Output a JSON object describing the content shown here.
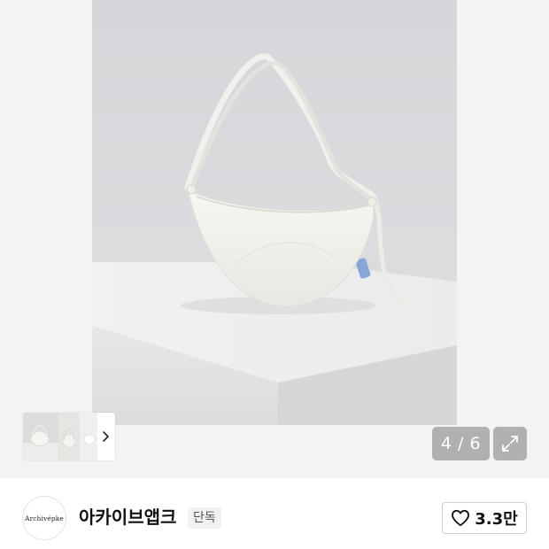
{
  "gallery": {
    "image_counter": "4 / 6",
    "expand_icon": "expand-icon",
    "thumbnail_next_icon": "chevron-right-icon"
  },
  "brand": {
    "logo_text": "Archivépke",
    "name": "아카이브앱크",
    "badge": "단독"
  },
  "like": {
    "icon": "heart-outline-icon",
    "count": "3.3만"
  },
  "colors": {
    "badge_bg": "#f1f1f1",
    "overlay_bg": "#787878",
    "border": "#cfcfcf"
  }
}
